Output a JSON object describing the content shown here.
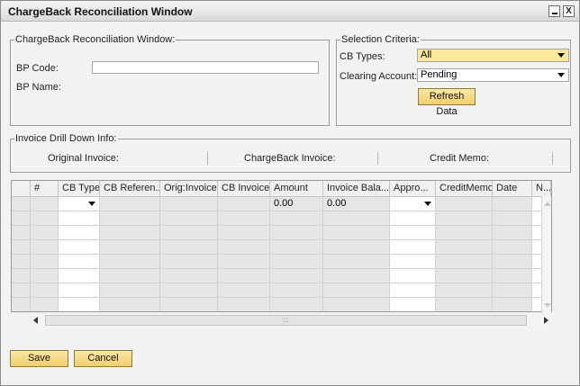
{
  "window": {
    "title": "ChargeBack Reconciliation Window",
    "minimize_glyph": "_",
    "close_glyph": "X"
  },
  "left_group": {
    "legend": "ChargeBack Reconciliation Window:",
    "bp_code_label": "BP Code:",
    "bp_code_value": "",
    "bp_name_label": "BP Name:"
  },
  "selection": {
    "legend": "Selection Criteria:",
    "cb_types_label": "CB Types:",
    "cb_types_value": "All",
    "clearing_label": "Clearing Account:",
    "clearing_value": "Pending",
    "refresh_label": "Refresh Data"
  },
  "drill": {
    "legend": "Invoice Drill Down Info:",
    "original_label": "Original  Invoice:",
    "chargeback_label": "ChargeBack Invoice:",
    "credit_label": "Credit Memo:"
  },
  "grid": {
    "columns": [
      "#",
      "CB Type",
      "CB Referen...",
      "Orig:Invoice",
      "CB Invoice",
      "Amount",
      "Invoice Bala...",
      "Appro...",
      "CreditMemo",
      "Date",
      "N..."
    ],
    "first_row": {
      "amount": "0.00",
      "invoice_balance": "0.00"
    }
  },
  "footer": {
    "save_label": "Save",
    "cancel_label": "Cancel"
  },
  "colors": {
    "button_yellow": "#f0cf6a",
    "field_yellow": "#fbe89a",
    "window_bg": "#f2f2f2"
  }
}
